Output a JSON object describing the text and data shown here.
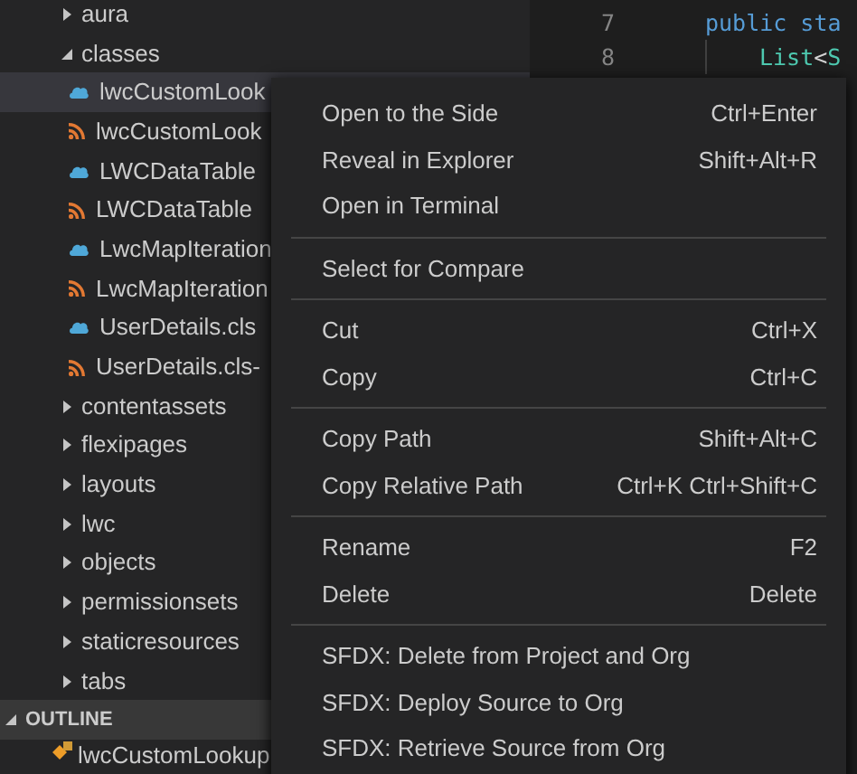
{
  "explorer": {
    "items": [
      {
        "label": "aura",
        "expanded": false,
        "selected": false
      },
      {
        "label": "classes",
        "expanded": true,
        "selected": false,
        "children": [
          {
            "label": "lwcCustomLook",
            "kind": "apex",
            "selected": true
          },
          {
            "label": "lwcCustomLook",
            "kind": "meta",
            "selected": false
          },
          {
            "label": "LWCDataTable",
            "kind": "apex",
            "selected": false
          },
          {
            "label": "LWCDataTable",
            "kind": "meta",
            "selected": false
          },
          {
            "label": "LwcMapIteration",
            "kind": "apex",
            "selected": false
          },
          {
            "label": "LwcMapIteration",
            "kind": "meta",
            "selected": false
          },
          {
            "label": "UserDetails.cls",
            "kind": "apex",
            "selected": false
          },
          {
            "label": "UserDetails.cls-",
            "kind": "meta",
            "selected": false
          }
        ]
      },
      {
        "label": "contentassets",
        "expanded": false,
        "selected": false
      },
      {
        "label": "flexipages",
        "expanded": false,
        "selected": false
      },
      {
        "label": "layouts",
        "expanded": false,
        "selected": false
      },
      {
        "label": "lwc",
        "expanded": false,
        "selected": false
      },
      {
        "label": "objects",
        "expanded": false,
        "selected": false
      },
      {
        "label": "permissionsets",
        "expanded": false,
        "selected": false
      },
      {
        "label": "staticresources",
        "expanded": false,
        "selected": false
      },
      {
        "label": "tabs",
        "expanded": false,
        "selected": false
      }
    ]
  },
  "outline": {
    "title": "OUTLINE",
    "expanded": true,
    "items": [
      {
        "label": "lwcCustomLookup"
      }
    ]
  },
  "editor": {
    "lines": [
      {
        "number": "7",
        "tokens": [
          {
            "text": "public sta",
            "kind": "keyword"
          }
        ],
        "children": [
          {
            "number": "8",
            "tokens": [
              {
                "text": "List",
                "kind": "type"
              },
              {
                "text": "<",
                "kind": "punct"
              },
              {
                "text": "S",
                "kind": "type"
              }
            ]
          }
        ]
      }
    ]
  },
  "context_menu": {
    "groups": [
      [
        {
          "label": "Open to the Side",
          "shortcut": "Ctrl+Enter"
        },
        {
          "label": "Reveal in Explorer",
          "shortcut": "Shift+Alt+R"
        },
        {
          "label": "Open in Terminal"
        }
      ],
      [
        {
          "label": "Select for Compare"
        }
      ],
      [
        {
          "label": "Cut",
          "shortcut": "Ctrl+X"
        },
        {
          "label": "Copy",
          "shortcut": "Ctrl+C"
        }
      ],
      [
        {
          "label": "Copy Path",
          "shortcut": "Shift+Alt+C"
        },
        {
          "label": "Copy Relative Path",
          "shortcut": "Ctrl+K Ctrl+Shift+C"
        }
      ],
      [
        {
          "label": "Rename",
          "shortcut": "F2"
        },
        {
          "label": "Delete",
          "shortcut": "Delete"
        }
      ],
      [
        {
          "label": "SFDX: Delete from Project and Org"
        },
        {
          "label": "SFDX: Deploy Source to Org"
        },
        {
          "label": "SFDX: Retrieve Source from Org"
        }
      ]
    ]
  }
}
